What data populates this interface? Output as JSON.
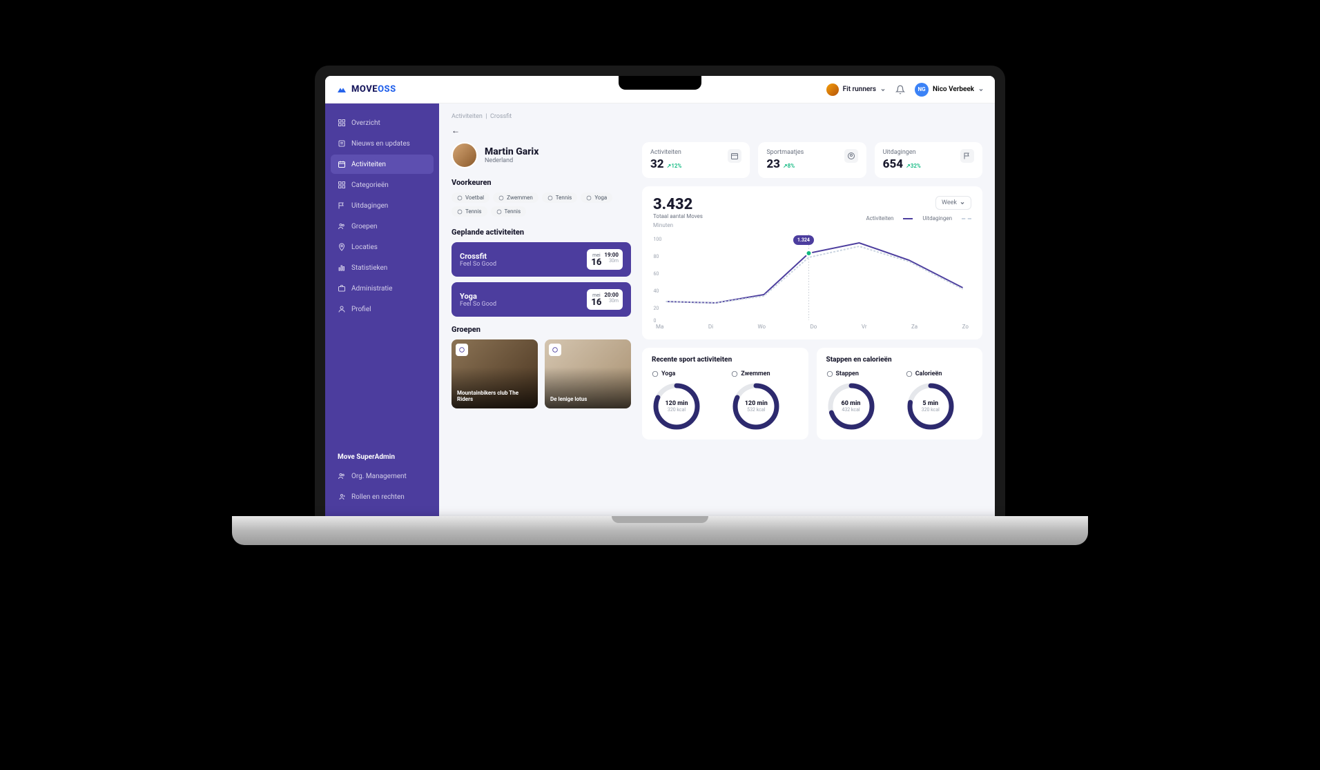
{
  "logo": {
    "brand": "MOVE",
    "suffix": "OSS"
  },
  "topbar": {
    "org": "Fit runners",
    "user_initials": "NG",
    "user_name": "Nico Verbeek"
  },
  "sidebar": {
    "items": [
      {
        "label": "Overzicht",
        "icon": "dashboard"
      },
      {
        "label": "Nieuws en updates",
        "icon": "news"
      },
      {
        "label": "Activiteiten",
        "icon": "calendar",
        "active": true
      },
      {
        "label": "Categorieën",
        "icon": "grid"
      },
      {
        "label": "Uitdagingen",
        "icon": "flag"
      },
      {
        "label": "Groepen",
        "icon": "users"
      },
      {
        "label": "Locaties",
        "icon": "pin"
      },
      {
        "label": "Statistieken",
        "icon": "bar"
      },
      {
        "label": "Administratie",
        "icon": "briefcase"
      },
      {
        "label": "Profiel",
        "icon": "user"
      }
    ],
    "admin_title": "Move SuperAdmin",
    "admin_items": [
      {
        "label": "Org. Management",
        "icon": "org"
      },
      {
        "label": "Rollen en rechten",
        "icon": "roles"
      }
    ]
  },
  "breadcrumb": {
    "parent": "Activiteiten",
    "sep": "|",
    "current": "Crossfit"
  },
  "profile": {
    "name": "Martin Garix",
    "country": "Nederland"
  },
  "prefs": {
    "title": "Voorkeuren",
    "items": [
      "Voetbal",
      "Zwemmen",
      "Tennis",
      "Yoga",
      "Tennis",
      "Tennis"
    ]
  },
  "planned": {
    "title": "Geplande activiteiten",
    "items": [
      {
        "name": "Crossfit",
        "sub": "Feel So Good",
        "month": "mei",
        "day": "16",
        "time": "19:00",
        "dur": "30m"
      },
      {
        "name": "Yoga",
        "sub": "Feel So Good",
        "month": "mei",
        "day": "16",
        "time": "20:00",
        "dur": "30m"
      }
    ]
  },
  "groups": {
    "title": "Groepen",
    "items": [
      {
        "name": "Mountainbikers club The Riders"
      },
      {
        "name": "De lenige lotus"
      }
    ]
  },
  "stats": [
    {
      "label": "Activiteiten",
      "value": "32",
      "delta": "↗12%"
    },
    {
      "label": "Sportmaatjes",
      "value": "23",
      "delta": "↗8%"
    },
    {
      "label": "Uitdagingen",
      "value": "654",
      "delta": "↗32%"
    }
  ],
  "chart": {
    "total": "3.432",
    "sublabel": "Totaal aantal Moves",
    "unit": "Minuten",
    "period": "Week",
    "legend": {
      "a": "Activiteiten",
      "b": "Uitdagingen"
    },
    "tooltip": "1.324"
  },
  "chart_data": {
    "type": "line",
    "categories": [
      "Ma",
      "Di",
      "Wo",
      "Do",
      "Vr",
      "Za",
      "Zo"
    ],
    "y_ticks": [
      0,
      20,
      40,
      60,
      80,
      100
    ],
    "series": [
      {
        "name": "Activiteiten",
        "values": [
          24,
          22,
          32,
          80,
          92,
          72,
          42
        ]
      },
      {
        "name": "Uitdagingen",
        "values": [
          24,
          22,
          30,
          75,
          88,
          70,
          40
        ]
      }
    ],
    "ylabel": "Minuten",
    "ylim": [
      0,
      100
    ],
    "highlight": {
      "x": "Do",
      "value": 1324
    }
  },
  "recent": {
    "title": "Recente sport activiteiten",
    "items": [
      {
        "name": "Yoga",
        "val": "120 min",
        "sub": "320 kcal",
        "pct": 82
      },
      {
        "name": "Zwemmen",
        "val": "120 min",
        "sub": "532 kcal",
        "pct": 82
      }
    ]
  },
  "steps": {
    "title": "Stappen en calorieën",
    "items": [
      {
        "name": "Stappen",
        "val": "60 min",
        "sub": "432 kcal",
        "pct": 70
      },
      {
        "name": "Calorieën",
        "val": "5 min",
        "sub": "320 kcal",
        "pct": 78
      }
    ]
  }
}
